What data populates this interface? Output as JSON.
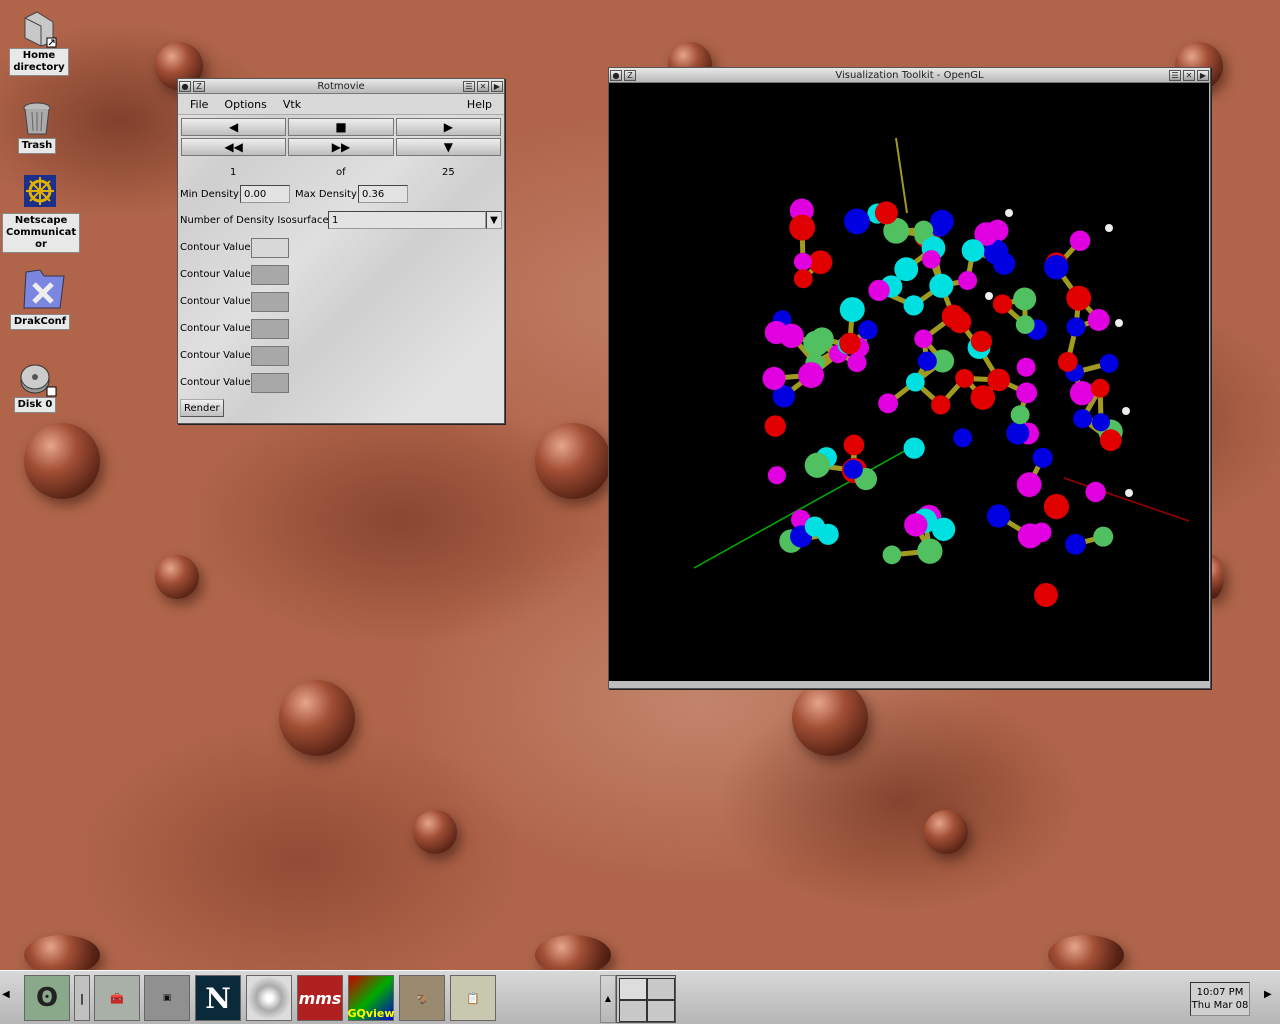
{
  "desktop": {
    "icons": [
      {
        "label": "Home\ndirectory"
      },
      {
        "label": "Trash"
      },
      {
        "label": "Netscape\nCommunicat\nor"
      },
      {
        "label": "DrakConf"
      },
      {
        "label": "Disk 0"
      }
    ]
  },
  "rotmovie": {
    "title": "Rotmovie",
    "menu": {
      "file": "File",
      "options": "Options",
      "vtk": "Vtk",
      "help": "Help"
    },
    "frame": {
      "current": "1",
      "of": "of",
      "total": "25"
    },
    "min_density_label": "Min Density",
    "min_density_value": "0.00",
    "max_density_label": "Max Density",
    "max_density_value": "0.36",
    "isosurfaces_label": "Number of Density Isosurfaces",
    "isosurfaces_value": "1",
    "contour_label": "Contour Value",
    "contour_rows": 6,
    "render_label": "Render"
  },
  "vtk_window": {
    "title": "Visualization Toolkit - OpenGL"
  },
  "taskbar": {
    "launchers": [
      "gnome-foot",
      "pager-handle",
      "toolbox",
      "terminal",
      "N",
      "cd-player",
      "mms",
      "GQview",
      "gimp",
      "notepad"
    ],
    "gqview_label": "GQview",
    "mms_label": "mms",
    "netscape_label": "N",
    "clock_time": "10:07 PM",
    "clock_date": "Thu Mar 08"
  },
  "colors": {
    "atom_red": "#e00000",
    "atom_blue": "#0000e0",
    "atom_magenta": "#e000e0",
    "atom_cyan": "#00e0e0",
    "atom_green": "#50c060",
    "bond": "#a09a20"
  }
}
